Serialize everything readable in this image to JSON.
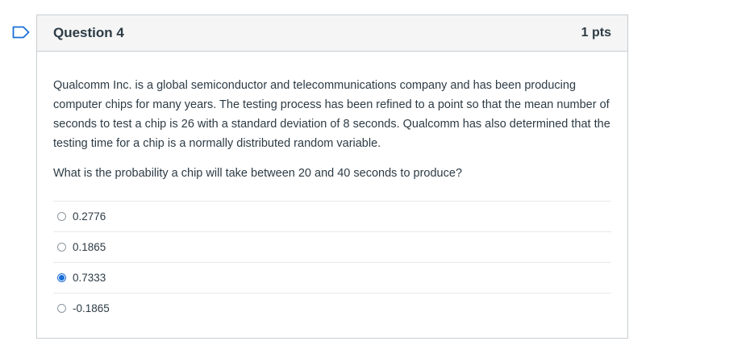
{
  "question": {
    "title": "Question 4",
    "points": "1 pts",
    "paragraphs": [
      "Qualcomm Inc. is a global semiconductor and telecommunications company and has been producing computer chips for many years. The testing process has been refined to a point so that the mean number of seconds to test a chip is 26 with a standard deviation of 8 seconds. Qualcomm has also determined that the testing time for a chip is a normally distributed random variable.",
      "What is the probability a chip will take between 20 and 40 seconds to produce?"
    ],
    "answers": [
      {
        "label": "0.2776",
        "selected": false
      },
      {
        "label": "0.1865",
        "selected": false
      },
      {
        "label": "0.7333",
        "selected": true
      },
      {
        "label": "-0.1865",
        "selected": false
      }
    ]
  },
  "icons": {
    "flag": "flag-question-icon"
  },
  "colors": {
    "accent": "#1a6fd6",
    "header_bg": "#f5f5f5",
    "border": "#c7cdd1",
    "text": "#2d3b45"
  }
}
